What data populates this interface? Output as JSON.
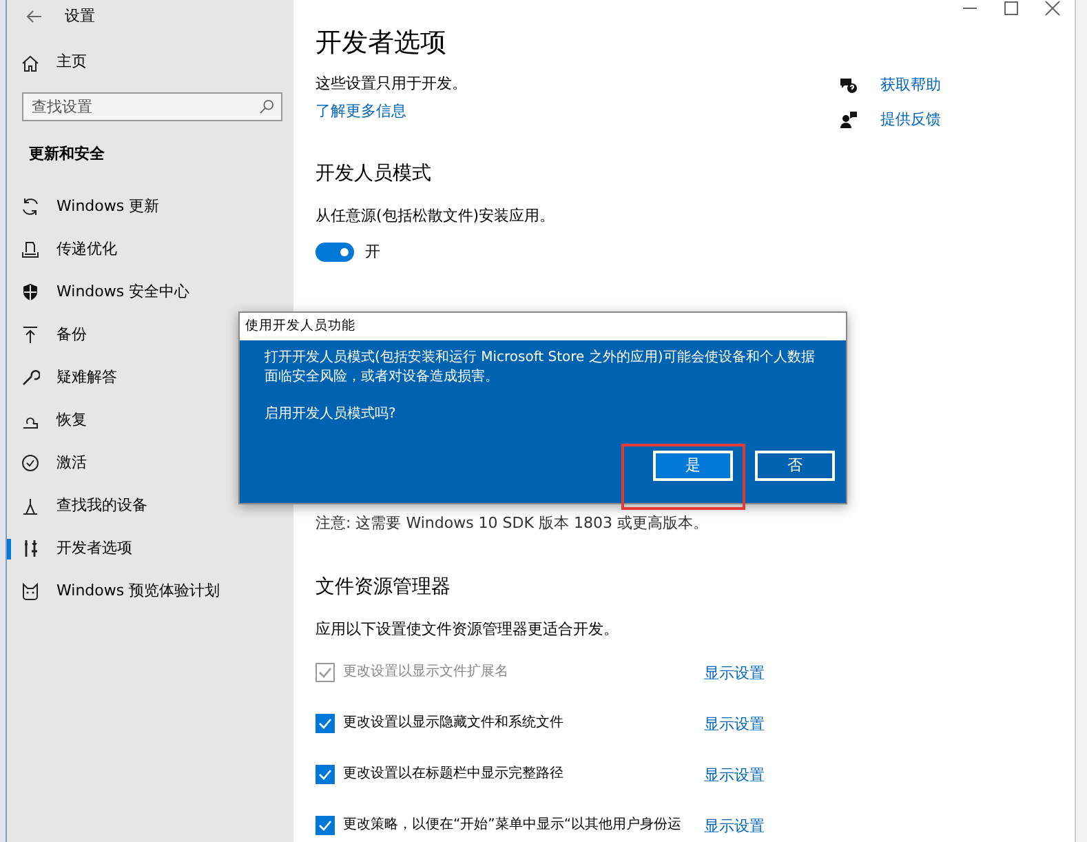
{
  "window": {
    "title": "设置"
  },
  "sidebar": {
    "home": "主页",
    "search": {
      "placeholder": "查找设置"
    },
    "section": "更新和安全",
    "items": [
      {
        "label": "Windows 更新",
        "selected": false
      },
      {
        "label": "传递优化",
        "selected": false
      },
      {
        "label": "Windows 安全中心",
        "selected": false
      },
      {
        "label": "备份",
        "selected": false
      },
      {
        "label": "疑难解答",
        "selected": false
      },
      {
        "label": "恢复",
        "selected": false
      },
      {
        "label": "激活",
        "selected": false
      },
      {
        "label": "查找我的设备",
        "selected": false
      },
      {
        "label": "开发者选项",
        "selected": true
      },
      {
        "label": "Windows 预览体验计划",
        "selected": false
      }
    ]
  },
  "page": {
    "title": "开发者选项",
    "intro": "这些设置只用于开发。",
    "learn_more": "了解更多信息",
    "help_links": [
      "获取帮助",
      "提供反馈"
    ],
    "dev_mode": {
      "heading": "开发人员模式",
      "description": "从任意源(包括松散文件)安装应用。",
      "toggle": {
        "on": true,
        "label": "开"
      }
    },
    "note": "注意: 这需要 Windows 10 SDK 版本 1803 或更高版本。",
    "explorer": {
      "heading": "文件资源管理器",
      "description": "应用以下设置使文件资源管理器更适合开发。",
      "options": [
        {
          "label": "更改设置以显示文件扩展名",
          "checked": true,
          "disabled": true,
          "link": "显示设置"
        },
        {
          "label": "更改设置以显示隐藏文件和系统文件",
          "checked": true,
          "disabled": false,
          "link": "显示设置"
        },
        {
          "label": "更改设置以在标题栏中显示完整路径",
          "checked": true,
          "disabled": false,
          "link": "显示设置"
        },
        {
          "label": "更改策略，以便在“开始”菜单中显示“以其他用户身份运",
          "checked": true,
          "disabled": false,
          "link": "显示设置"
        }
      ]
    }
  },
  "dialog": {
    "title": "使用开发人员功能",
    "message": "打开开发人员模式(包括安装和运行 Microsoft Store 之外的应用)可能会使设备和个人数据面临安全风险，或者对设备造成损害。",
    "question": "启用开发人员模式吗?",
    "buttons": [
      {
        "label": "是",
        "focused": true,
        "highlighted": true
      },
      {
        "label": "否",
        "focused": false,
        "highlighted": false
      }
    ]
  }
}
